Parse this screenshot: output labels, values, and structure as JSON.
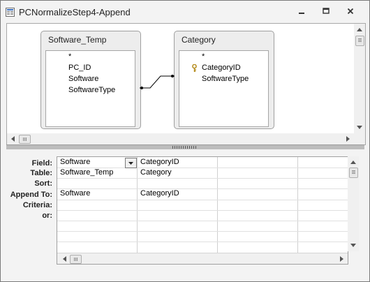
{
  "window": {
    "title": "PCNormalizeStep4-Append"
  },
  "tables": [
    {
      "name": "Software_Temp",
      "fields": [
        "*",
        "PC_ID",
        "Software",
        "SoftwareType"
      ]
    },
    {
      "name": "Category",
      "fields": [
        "*",
        "CategoryID",
        "SoftwareType"
      ]
    }
  ],
  "grid": {
    "row_labels": [
      "Field:",
      "Table:",
      "Sort:",
      "Append To:",
      "Criteria:",
      "or:"
    ],
    "columns": [
      {
        "field": "Software",
        "table": "Software_Temp",
        "sort": "",
        "append_to": "Software",
        "criteria": "",
        "or": ""
      },
      {
        "field": "CategoryID",
        "table": "Category",
        "sort": "",
        "append_to": "CategoryID",
        "criteria": "",
        "or": ""
      }
    ]
  },
  "icons": {
    "app": "query-icon",
    "minimize": "minimize-icon",
    "restore": "restore-icon",
    "close": "close-icon",
    "key": "primary-key-icon"
  }
}
